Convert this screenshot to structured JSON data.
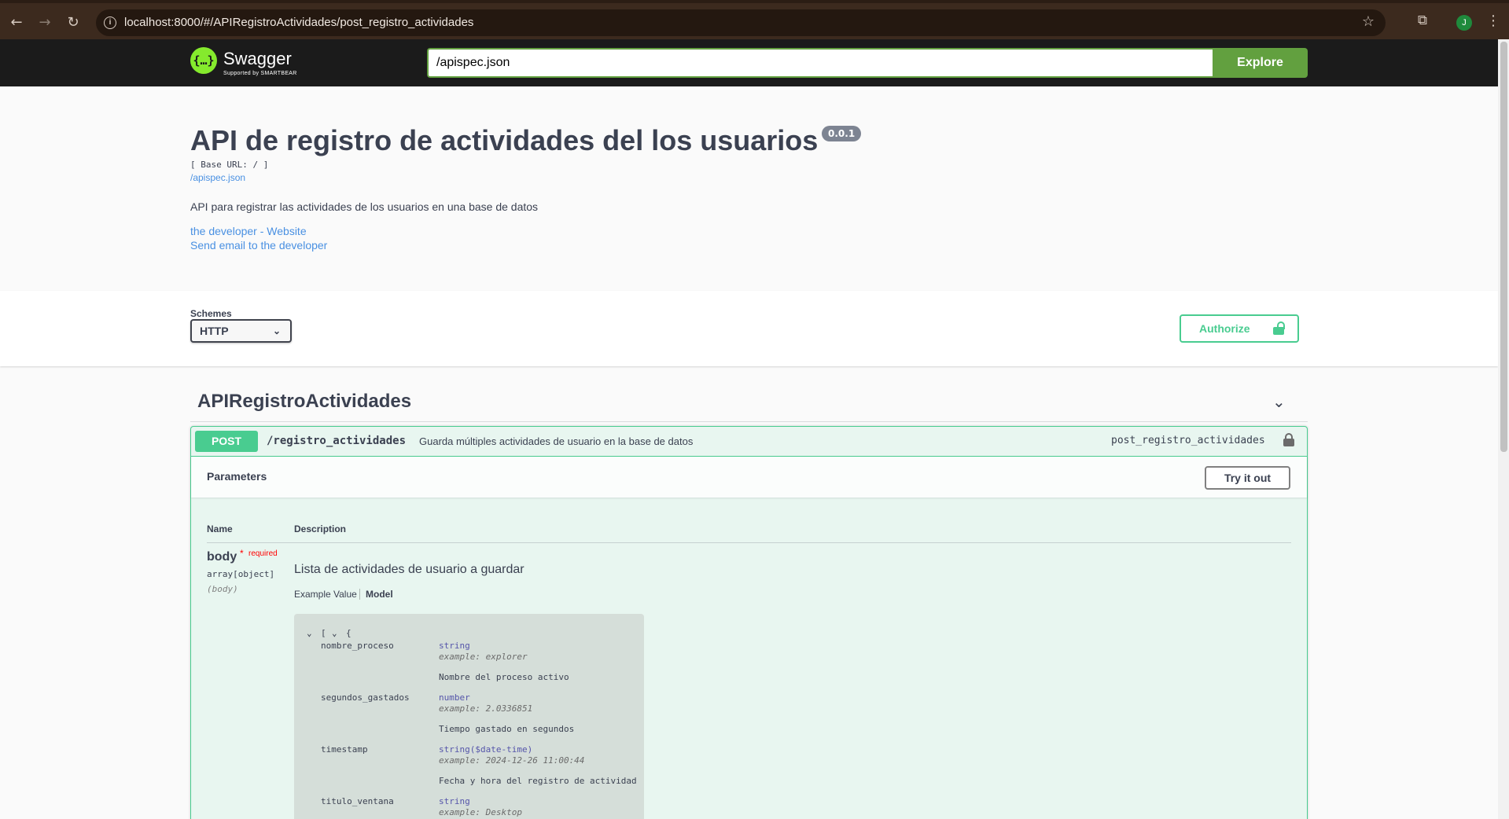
{
  "browser": {
    "url": "localhost:8000/#/APIRegistroActividades/post_registro_actividades",
    "back_icon": "←",
    "forward_icon": "→",
    "reload_icon": "↻",
    "info_icon": "i",
    "star_icon": "☆",
    "extensions_icon": "⧉",
    "profile_initial": "J",
    "menu_icon": "⋮"
  },
  "topbar": {
    "logo_symbol": "{…}",
    "logo_text": "Swagger",
    "logo_sub": "Supported by SMARTBEAR",
    "spec_url": "/apispec.json",
    "explore_label": "Explore"
  },
  "info": {
    "title": "API de registro de actividades del los usuarios",
    "version": "0.0.1",
    "base_url": "[ Base URL: / ]",
    "spec_link": "/apispec.json",
    "description": "API para registrar las actividades de los usuarios en una base de datos",
    "dev_website": "the developer - Website",
    "dev_email": "Send email to the developer"
  },
  "schemes": {
    "label": "Schemes",
    "selected": "HTTP",
    "chevron": "⌄",
    "authorize_label": "Authorize"
  },
  "tag": {
    "name": "APIRegistroActividades",
    "chevron": "⌄"
  },
  "operation": {
    "method": "POST",
    "path": "/registro_actividades",
    "summary": "Guarda múltiples actividades de usuario en la base de datos",
    "operation_id": "post_registro_actividades",
    "parameters_title": "Parameters",
    "try_label": "Try it out",
    "col_name": "Name",
    "col_desc": "Description",
    "param": {
      "name": "body",
      "required_star": "*",
      "required_label": "required",
      "type": "array[object]",
      "in": "(body)",
      "description": "Lista de actividades de usuario a guardar"
    },
    "tabs": {
      "example": "Example Value",
      "model": "Model"
    },
    "model": {
      "array_open": "[",
      "object_open": "{",
      "toggle_icon": "⌄",
      "properties": [
        {
          "name": "nombre_proceso",
          "type": "string",
          "example": "example: explorer",
          "desc": "Nombre del proceso activo"
        },
        {
          "name": "segundos_gastados",
          "type": "number",
          "example": "example: 2.0336851",
          "desc": "Tiempo gastado en segundos"
        },
        {
          "name": "timestamp",
          "type": "string($date-time)",
          "example": "example: 2024-12-26 11:00:44",
          "desc": "Fecha y hora del registro de actividad"
        },
        {
          "name": "titulo_ventana",
          "type": "string",
          "example": "example: Desktop",
          "desc": ""
        }
      ]
    }
  }
}
